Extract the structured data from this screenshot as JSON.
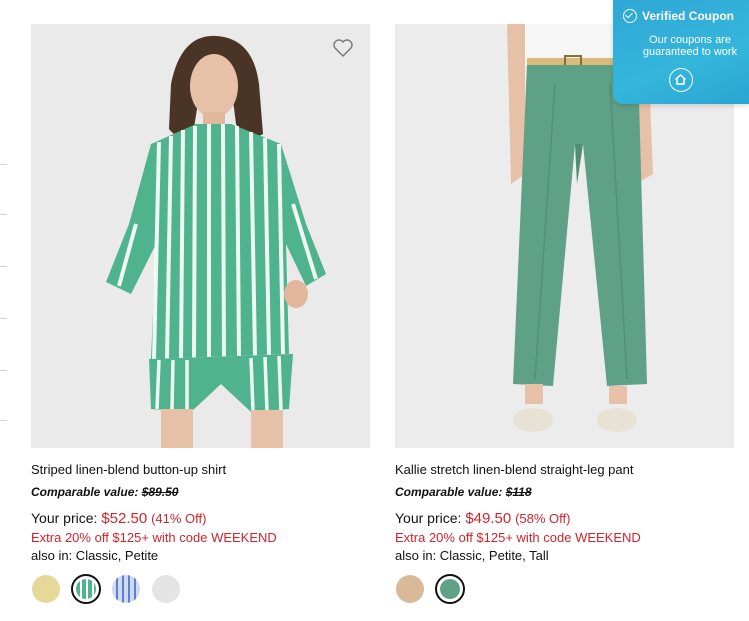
{
  "products": [
    {
      "name": "Striped linen-blend button-up shirt",
      "comparable_label": "Comparable value:",
      "comparable_value": "$89.50",
      "your_price_label": "Your price:",
      "price": "$52.50",
      "discount": "(41% Off)",
      "promo": "Extra 20% off $125+ with code WEEKEND",
      "also_in": "also in: Classic, Petite",
      "swatches": [
        "sand-yellow",
        "green-stripe",
        "blue-stripe",
        "light-gray"
      ],
      "selected_swatch": 1
    },
    {
      "name": "Kallie stretch linen-blend straight-leg pant",
      "comparable_label": "Comparable value:",
      "comparable_value": "$118",
      "your_price_label": "Your price:",
      "price": "$49.50",
      "discount": "(58% Off)",
      "promo": "Extra 20% off $125+ with code WEEKEND",
      "also_in": "also in: Classic, Petite, Tall",
      "swatches": [
        "tan",
        "sage-green"
      ],
      "selected_swatch": 1
    }
  ],
  "coupon": {
    "title": "Verified Coupon",
    "subtitle": "Our coupons are guaranteed to work",
    "icon": "home-icon"
  },
  "colors": {
    "price_red": "#d0242b",
    "coupon_blue": "#2fa7d6",
    "shirt_green": "#4fb38e",
    "pant_green": "#5fa187"
  }
}
